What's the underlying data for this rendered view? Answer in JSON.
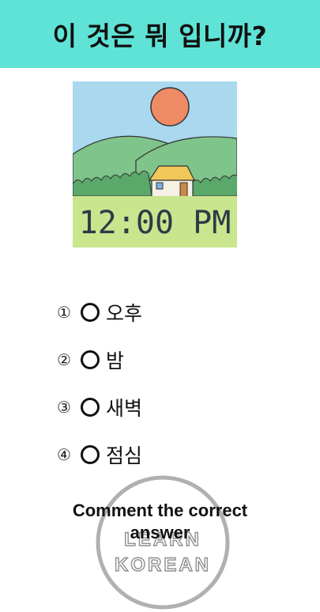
{
  "header": {
    "title": "이 것은 뭐 입니까?"
  },
  "scene": {
    "clock_text": "12:00 PM"
  },
  "options": [
    {
      "number": "①",
      "label": "오후"
    },
    {
      "number": "②",
      "label": "밤"
    },
    {
      "number": "③",
      "label": "새벽"
    },
    {
      "number": "④",
      "label": "점심"
    }
  ],
  "watermark": {
    "line1": "LEARN",
    "line2": "KOREAN"
  },
  "cta": {
    "line1": "Comment the correct",
    "line2": "answer"
  },
  "colors": {
    "header_bg": "#5fe3d6",
    "sky": "#a9d8ef",
    "sun": "#ee8a64",
    "hills": "#7fc48a",
    "grass": "#c9e58e",
    "clock_text": "#2f3a46"
  },
  "icons": [
    "option-circle-icon",
    "house-icon",
    "sun-icon",
    "logo-ring-icon"
  ]
}
